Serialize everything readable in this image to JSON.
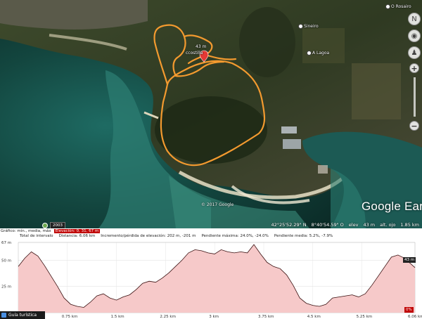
{
  "map": {
    "labels": {
      "o_rosairo": "O Rosairo",
      "lagoa": "A Lagoa",
      "sineiro": "Sineiro",
      "ccosta": "ccostilla",
      "elev_mark": "43 m"
    },
    "copyright": "© 2017 Google",
    "brand": "Google Earth",
    "history_year": "2003",
    "status": {
      "lat": "42°25'52.29\" N",
      "lon": "8°40'54.59\" O",
      "elev_label": "elev",
      "elev_value": "43 m",
      "eye_label": "alt. ojo",
      "eye_value": "1.85 km"
    },
    "colors": {
      "track": "#f39a2f",
      "pin": "#e53935"
    }
  },
  "elevation": {
    "row1": {
      "graph_label": "Gráfico: mín., media, máx",
      "elev_range": "Elevación: 0, 31, 67 m"
    },
    "row2": {
      "total_label": "Total de intervalo",
      "distance": "Distancia: 6.06 km",
      "gain_loss": "Incremento/pérdida de elevación: 202 m, -201 m",
      "max_slope": "Pendiente máxima: 24.0%, -24.0%",
      "avg_slope": "Pendiente media: 5.2%, -7.9%"
    },
    "y_ticks": [
      "67 m",
      "50 m",
      "25 m",
      "0 m"
    ],
    "x_ticks": [
      "0.75 km",
      "1.5 km",
      "2.25 km",
      "3 km",
      "3.75 km",
      "4.5 km",
      "5.25 km",
      "6.06 km"
    ],
    "current_value": "43 m",
    "current_slope": "0%",
    "tour_guide": "Guía turística"
  },
  "chart_data": {
    "type": "area",
    "xlabel": "",
    "ylabel": "",
    "ylim": [
      0,
      67
    ],
    "x": [
      0,
      0.1,
      0.2,
      0.3,
      0.4,
      0.5,
      0.6,
      0.7,
      0.8,
      0.9,
      1.0,
      1.1,
      1.2,
      1.3,
      1.4,
      1.5,
      1.6,
      1.7,
      1.8,
      1.9,
      2.0,
      2.1,
      2.2,
      2.3,
      2.4,
      2.5,
      2.6,
      2.7,
      2.8,
      2.9,
      3.0,
      3.1,
      3.2,
      3.3,
      3.4,
      3.5,
      3.6,
      3.7,
      3.8,
      3.9,
      4.0,
      4.1,
      4.2,
      4.3,
      4.4,
      4.5,
      4.6,
      4.7,
      4.8,
      4.9,
      5.0,
      5.1,
      5.2,
      5.3,
      5.4,
      5.5,
      5.6,
      5.7,
      5.8,
      5.9,
      6.06
    ],
    "values": [
      44,
      52,
      58,
      54,
      45,
      35,
      25,
      14,
      8,
      6,
      5,
      10,
      16,
      18,
      14,
      12,
      15,
      17,
      22,
      28,
      30,
      29,
      33,
      38,
      44,
      50,
      57,
      60,
      59,
      57,
      56,
      60,
      58,
      57,
      58,
      57,
      65,
      56,
      48,
      44,
      42,
      36,
      26,
      14,
      9,
      7,
      6,
      8,
      14,
      15,
      16,
      17,
      15,
      18,
      26,
      35,
      44,
      53,
      55,
      52,
      43
    ]
  }
}
